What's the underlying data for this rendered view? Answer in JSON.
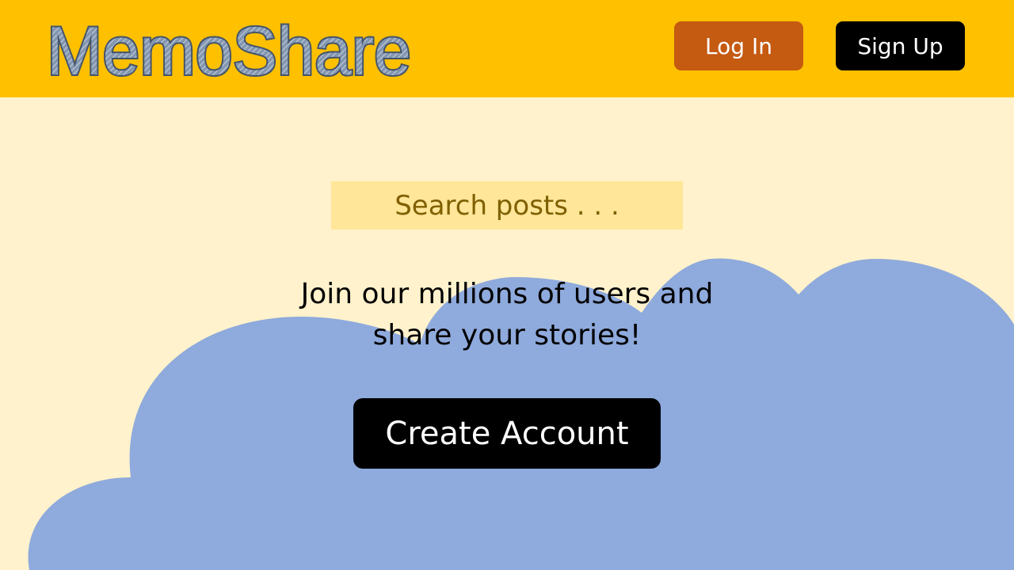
{
  "brand": {
    "name": "MemoShare",
    "colors": {
      "header_bg": "#FFC000",
      "page_bg": "#FFF2CC",
      "cloud": "#8FAADC",
      "logo_fill": "#8497B0",
      "logo_outline": "#44546A"
    }
  },
  "header": {
    "login_label": "Log In",
    "signup_label": "Sign Up",
    "login_color": "#C55A11",
    "signup_color": "#000000"
  },
  "search": {
    "placeholder": "Search posts . . ."
  },
  "hero": {
    "tagline_line1": "Join our millions of users and",
    "tagline_line2": "share your stories!",
    "cta_label": "Create Account"
  }
}
